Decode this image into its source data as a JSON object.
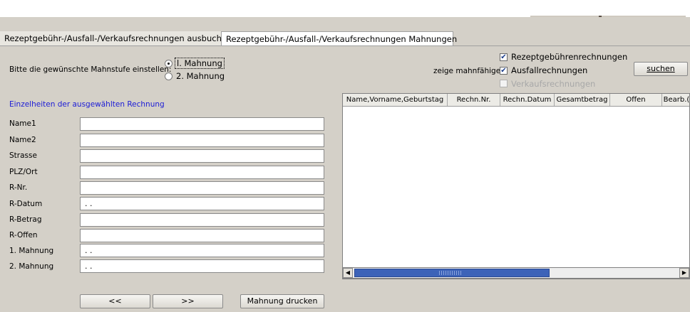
{
  "tabs": [
    {
      "label": "Rezeptgebühr-/Ausfall-/Verkaufsrechnungen ausbuchen",
      "active": false
    },
    {
      "label": "Rezeptgebühr-/Ausfall-/Verkaufsrechnungen Mahnungen",
      "active": true
    }
  ],
  "mahnstufe": {
    "prompt": "Bitte die gewünschte Mahnstufe einstellen:",
    "options": [
      {
        "label": "l. Mahnung",
        "selected": true
      },
      {
        "label": "2. Mahnung",
        "selected": false
      }
    ]
  },
  "filter": {
    "prompt": "zeige mahnfähige",
    "options": [
      {
        "label": "Rezeptgebührenrechnungen",
        "checked": true,
        "enabled": true
      },
      {
        "label": "Ausfallrechnungen",
        "checked": true,
        "enabled": true
      },
      {
        "label": "Verkaufsrechnungen",
        "checked": false,
        "enabled": false
      }
    ],
    "search_button": "suchen"
  },
  "details": {
    "title": "Einzelheiten der ausgewählten Rechnung",
    "fields": [
      {
        "label": "Name1",
        "value": ""
      },
      {
        "label": "Name2",
        "value": ""
      },
      {
        "label": "Strasse",
        "value": ""
      },
      {
        "label": "PLZ/Ort",
        "value": ""
      },
      {
        "label": "R-Nr.",
        "value": ""
      },
      {
        "label": "R-Datum",
        "value": ". ."
      },
      {
        "label": "R-Betrag",
        "value": ""
      },
      {
        "label": "R-Offen",
        "value": ""
      },
      {
        "label": "1. Mahnung",
        "value": ". ."
      },
      {
        "label": "2. Mahnung",
        "value": ". ."
      }
    ]
  },
  "table": {
    "columns": [
      "Name,Vorname,Geburtstag",
      "Rechn.Nr.",
      "Rechn.Datum",
      "Gesamtbetrag",
      "Offen",
      "Bearb.("
    ],
    "rows": []
  },
  "buttons": {
    "prev": "<<",
    "next": ">>",
    "print": "Mahnung drucken"
  },
  "colors": {
    "background": "#d4d0c8",
    "link_blue": "#1b1bd6",
    "scroll_thumb": "#3d63b8"
  }
}
